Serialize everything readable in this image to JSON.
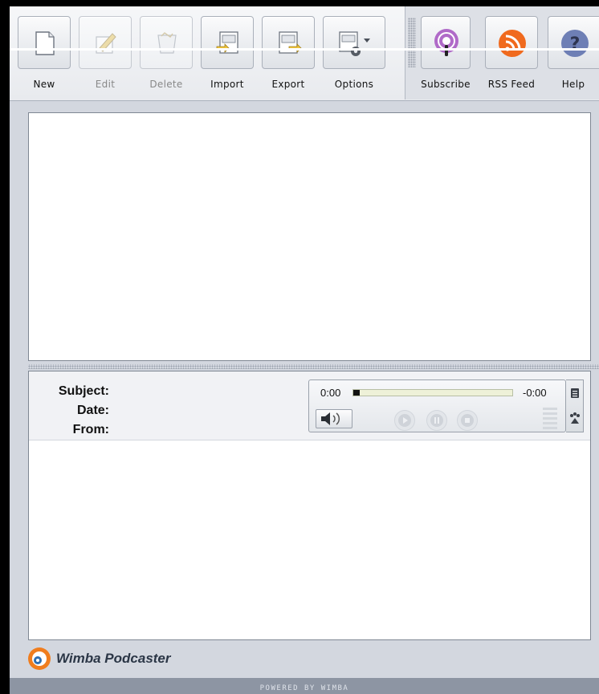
{
  "toolbar": {
    "main": [
      {
        "id": "new",
        "label": "New",
        "icon": "new-document-icon",
        "enabled": true
      },
      {
        "id": "edit",
        "label": "Edit",
        "icon": "edit-pencil-icon",
        "enabled": false
      },
      {
        "id": "delete",
        "label": "Delete",
        "icon": "trash-icon",
        "enabled": false
      },
      {
        "id": "import",
        "label": "Import",
        "icon": "import-icon",
        "enabled": true
      },
      {
        "id": "export",
        "label": "Export",
        "icon": "export-icon",
        "enabled": true
      },
      {
        "id": "options",
        "label": "Options",
        "icon": "options-gear-dropdown-icon",
        "enabled": true
      }
    ],
    "right": [
      {
        "id": "subscribe",
        "label": "Subscribe",
        "icon": "podcast-microphone-icon",
        "color": "#b06ac8"
      },
      {
        "id": "rss",
        "label": "RSS Feed",
        "icon": "rss-feed-icon",
        "color": "#f06a1e"
      },
      {
        "id": "help",
        "label": "Help",
        "icon": "help-question-icon",
        "color": "#6e7fb5"
      }
    ]
  },
  "detail": {
    "subject_label": "Subject:",
    "date_label": "Date:",
    "from_label": "From:"
  },
  "player": {
    "elapsed": "0:00",
    "remaining": "-0:00",
    "progress": 0.04
  },
  "brand": {
    "name": "Wimba Podcaster",
    "icon": "wimba-logo-icon",
    "color": "#f07d1e"
  },
  "footer": {
    "text": "POWERED BY WIMBA"
  }
}
